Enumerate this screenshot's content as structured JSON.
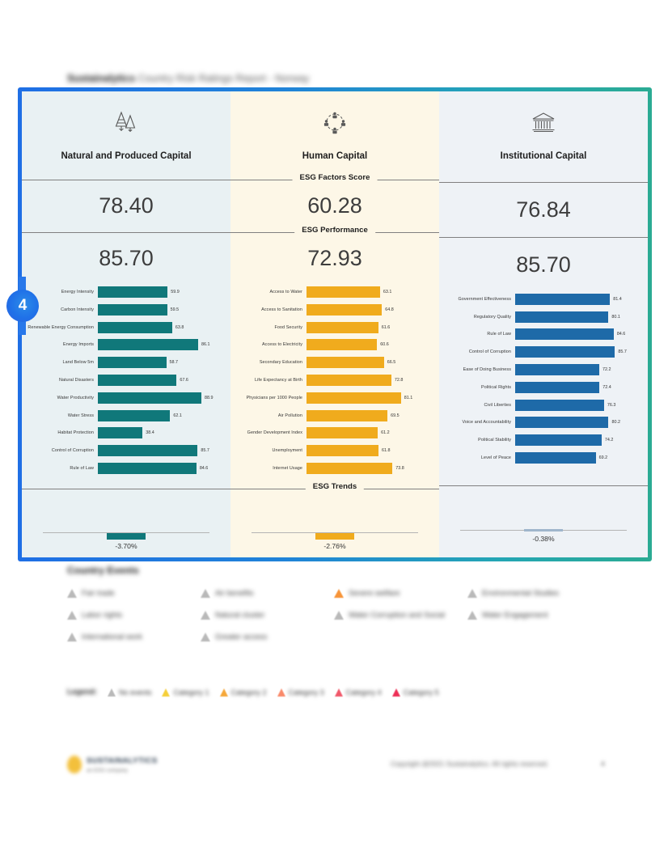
{
  "report": {
    "brand": "Sustainalytics",
    "title_rest": "Country Risk Ratings Report - Norway"
  },
  "annotation": {
    "step_number": "4"
  },
  "sections": {
    "factors_score_label": "ESG Factors Score",
    "performance_label": "ESG Performance",
    "trends_label": "ESG Trends"
  },
  "columns": [
    {
      "key": "environment",
      "title": "Natural and Produced Capital",
      "icon": "pine-trees-icon",
      "accent": "#10787a",
      "background": "#e9f1f3",
      "factors_score": "78.40",
      "performance": "85.70",
      "trend": "-3.70%",
      "indicators": [
        {
          "label": "Energy Intensity",
          "value": "59.9"
        },
        {
          "label": "Carbon Intensity",
          "value": "59.5"
        },
        {
          "label": "Renewable Energy Consumption",
          "value": "63.8"
        },
        {
          "label": "Energy Imports",
          "value": "86.1"
        },
        {
          "label": "Land Below 5m",
          "value": "58.7"
        },
        {
          "label": "Natural Disasters",
          "value": "67.6"
        },
        {
          "label": "Water Productivity",
          "value": "88.9"
        },
        {
          "label": "Water Stress",
          "value": "62.1"
        },
        {
          "label": "Habitat Protection",
          "value": "38.4"
        },
        {
          "label": "Control of Corruption",
          "value": "85.7"
        },
        {
          "label": "Rule of Law",
          "value": "84.6"
        }
      ]
    },
    {
      "key": "social",
      "title": "Human Capital",
      "icon": "people-network-icon",
      "accent": "#f0ab1d",
      "background": "#fdf7e7",
      "factors_score": "60.28",
      "performance": "72.93",
      "trend": "-2.76%",
      "indicators": [
        {
          "label": "Access to Water",
          "value": "63.1"
        },
        {
          "label": "Access to Sanitation",
          "value": "64.8"
        },
        {
          "label": "Food Security",
          "value": "61.6"
        },
        {
          "label": "Access to Electricity",
          "value": "60.6"
        },
        {
          "label": "Secondary Education",
          "value": "66.5"
        },
        {
          "label": "Life Expectancy at Birth",
          "value": "72.8"
        },
        {
          "label": "Physicians per 1000 People",
          "value": "81.1"
        },
        {
          "label": "Air Pollution",
          "value": "69.5"
        },
        {
          "label": "Gender Development Index",
          "value": "61.2"
        },
        {
          "label": "Unemployment",
          "value": "61.8"
        },
        {
          "label": "Internet Usage",
          "value": "73.8"
        }
      ]
    },
    {
      "key": "governance",
      "title": "Institutional Capital",
      "icon": "bank-building-icon",
      "accent": "#1e6aa8",
      "background": "#eef2f6",
      "factors_score": "76.84",
      "performance": "85.70",
      "trend": "-0.38%",
      "indicators": [
        {
          "label": "Government Effectiveness",
          "value": "81.4"
        },
        {
          "label": "Regulatory Quality",
          "value": "80.1"
        },
        {
          "label": "Rule of Law",
          "value": "84.6"
        },
        {
          "label": "Control of Corruption",
          "value": "85.7"
        },
        {
          "label": "Ease of Doing Business",
          "value": "72.2"
        },
        {
          "label": "Political Rights",
          "value": "72.4"
        },
        {
          "label": "Civil Liberties",
          "value": "76.3"
        },
        {
          "label": "Voice and Accountability",
          "value": "80.2"
        },
        {
          "label": "Political Stability",
          "value": "74.2"
        },
        {
          "label": "Level of Peace",
          "value": "69.2"
        }
      ]
    }
  ],
  "chart_data": [
    {
      "type": "bar",
      "title": "Natural and Produced Capital",
      "orientation": "horizontal",
      "categories": [
        "Energy Intensity",
        "Carbon Intensity",
        "Renewable Energy Consumption",
        "Energy Imports",
        "Land Below 5m",
        "Natural Disasters",
        "Water Productivity",
        "Water Stress",
        "Habitat Protection",
        "Control of Corruption",
        "Rule of Law"
      ],
      "values": [
        59.9,
        59.5,
        63.8,
        86.1,
        58.7,
        67.6,
        88.9,
        62.1,
        38.4,
        85.7,
        84.6
      ],
      "xlabel": "",
      "ylabel": "",
      "xlim": [
        0,
        100
      ],
      "color": "#10787a",
      "grid": false,
      "legend": "none"
    },
    {
      "type": "bar",
      "title": "Human Capital",
      "orientation": "horizontal",
      "categories": [
        "Access to Water",
        "Access to Sanitation",
        "Food Security",
        "Access to Electricity",
        "Secondary Education",
        "Life Expectancy at Birth",
        "Physicians per 1000 People",
        "Air Pollution",
        "Gender Development Index",
        "Unemployment",
        "Internet Usage"
      ],
      "values": [
        63.1,
        64.8,
        61.6,
        60.6,
        66.5,
        72.8,
        81.1,
        69.5,
        61.2,
        61.8,
        73.8
      ],
      "xlabel": "",
      "ylabel": "",
      "xlim": [
        0,
        100
      ],
      "color": "#f0ab1d",
      "grid": false,
      "legend": "none"
    },
    {
      "type": "bar",
      "title": "Institutional Capital",
      "orientation": "horizontal",
      "categories": [
        "Government Effectiveness",
        "Regulatory Quality",
        "Rule of Law",
        "Control of Corruption",
        "Ease of Doing Business",
        "Political Rights",
        "Civil Liberties",
        "Voice and Accountability",
        "Political Stability",
        "Level of Peace"
      ],
      "values": [
        81.4,
        80.1,
        84.6,
        85.7,
        72.2,
        72.4,
        76.3,
        80.2,
        74.2,
        69.2
      ],
      "xlabel": "",
      "ylabel": "",
      "xlim": [
        0,
        100
      ],
      "color": "#1e6aa8",
      "grid": false,
      "legend": "none"
    },
    {
      "type": "bar",
      "title": "ESG Trends",
      "categories": [
        "Natural and Produced Capital",
        "Human Capital",
        "Institutional Capital"
      ],
      "values": [
        -3.7,
        -2.76,
        -0.38
      ],
      "ylabel": "%",
      "grid": false,
      "legend": "none"
    }
  ],
  "events": {
    "title": "Country Events",
    "items": [
      {
        "text": "Fair trade",
        "severity": "none"
      },
      {
        "text": "Air benefits",
        "severity": "none"
      },
      {
        "text": "Severe welfare",
        "severity": "high"
      },
      {
        "text": "Environmental Studies",
        "severity": "none"
      },
      {
        "text": "Labor rights",
        "severity": "none"
      },
      {
        "text": "Natural cluster",
        "severity": "none"
      },
      {
        "text": "Water Corruption and Social",
        "severity": "none"
      },
      {
        "text": "Water Engagement",
        "severity": "none"
      },
      {
        "text": "International work",
        "severity": "none"
      },
      {
        "text": "Greater access",
        "severity": "none"
      }
    ]
  },
  "legend": {
    "title": "Legend:",
    "items": [
      {
        "label": "No events",
        "color": "#b9b9b9"
      },
      {
        "label": "Category 1",
        "color": "#f5cf3a"
      },
      {
        "label": "Category 2",
        "color": "#f5a83a"
      },
      {
        "label": "Category 3",
        "color": "#f98a6a"
      },
      {
        "label": "Category 4",
        "color": "#f0586a"
      },
      {
        "label": "Category 5",
        "color": "#ed2f56"
      }
    ]
  },
  "footer": {
    "logo_name": "SUSTAINALYTICS",
    "logo_sub": "an ESG company",
    "copyright": "Copyright @2021 Sustainalytics. All rights reserved.",
    "page_number": "4"
  }
}
